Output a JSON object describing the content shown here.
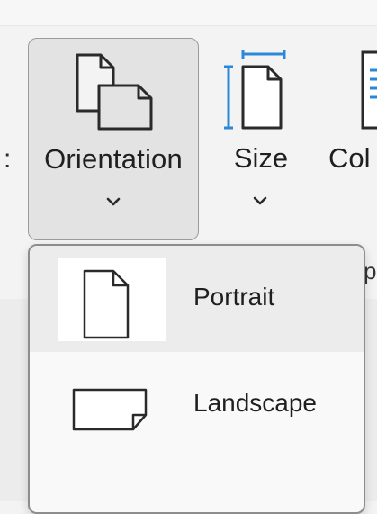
{
  "ribbon": {
    "left_cut_label": ":",
    "orientation_label": "Orientation",
    "size_label": "Size",
    "columns_label_cut": "Col",
    "group_label_cut": "p",
    "accent_color": "#2b88d8"
  },
  "dropdown": {
    "items": [
      {
        "label": "Portrait",
        "icon": "portrait-page-icon",
        "selected": true
      },
      {
        "label": "Landscape",
        "icon": "landscape-page-icon",
        "selected": false
      }
    ]
  }
}
